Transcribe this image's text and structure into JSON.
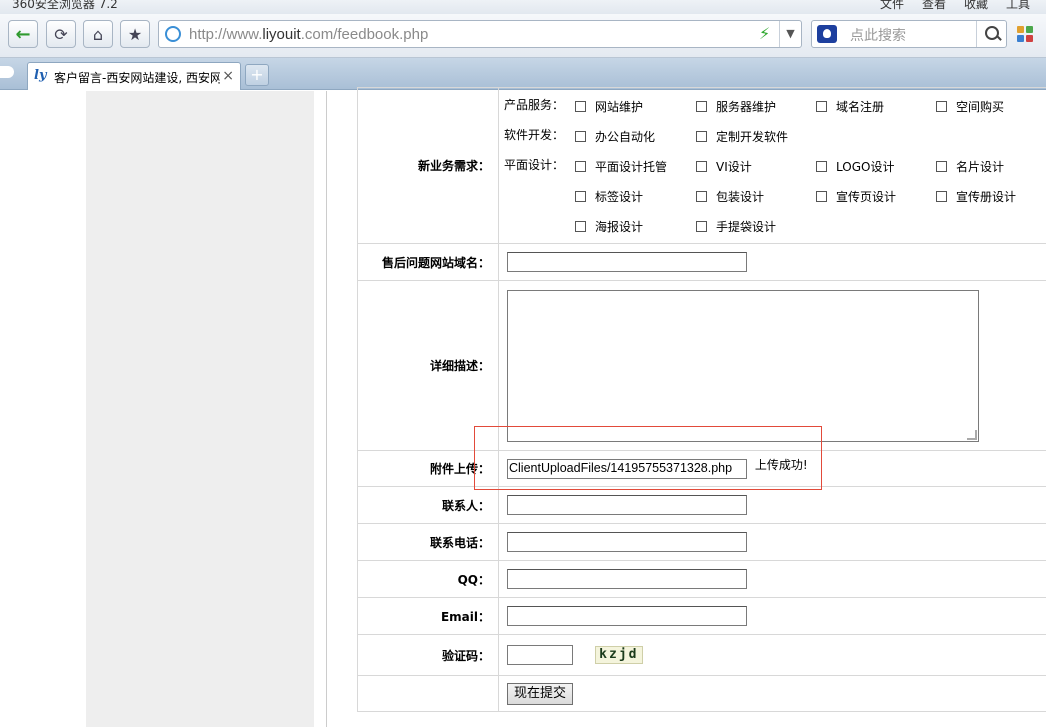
{
  "browser": {
    "app_title": "360安全浏览器 7.2",
    "menu": [
      "文件",
      "查看",
      "收藏",
      "工具"
    ],
    "url_prefix": "http://www.",
    "url_domain": "liyouit",
    "url_suffix": ".com/feedbook.php",
    "search_placeholder": "点此搜索",
    "tab_logo": "ly",
    "tab_title": "客户留言-西安网站建设, 西安网站",
    "tab_close": "×",
    "new_tab": "+"
  },
  "form": {
    "business": {
      "label": "新业务需求：",
      "groups": [
        {
          "label": "产品服务：",
          "options": [
            "网站维护",
            "服务器维护",
            "域名注册",
            "空间购买"
          ]
        },
        {
          "label": "软件开发：",
          "options": [
            "办公自动化",
            "定制开发软件"
          ]
        },
        {
          "label": "平面设计：",
          "options": [
            "平面设计托管",
            "VI设计",
            "LOGO设计",
            "名片设计",
            "标签设计",
            "包装设计",
            "宣传页设计",
            "宣传册设计",
            "海报设计",
            "手提袋设计"
          ]
        }
      ]
    },
    "domain_label": "售后问题网站域名：",
    "detail_label": "详细描述：",
    "attach_label": "附件上传：",
    "attach_value": "ClientUploadFiles/14195755371328.php",
    "attach_status": "上传成功!",
    "contact_label": "联系人：",
    "phone_label": "联系电话：",
    "qq_label": "QQ：",
    "email_label": "Email：",
    "captcha_label": "验证码：",
    "captcha_code": "kzjd",
    "submit_label": "现在提交"
  },
  "colors": {
    "highlight_box": "#e24a3a",
    "sidebar": "#eeeeee"
  }
}
